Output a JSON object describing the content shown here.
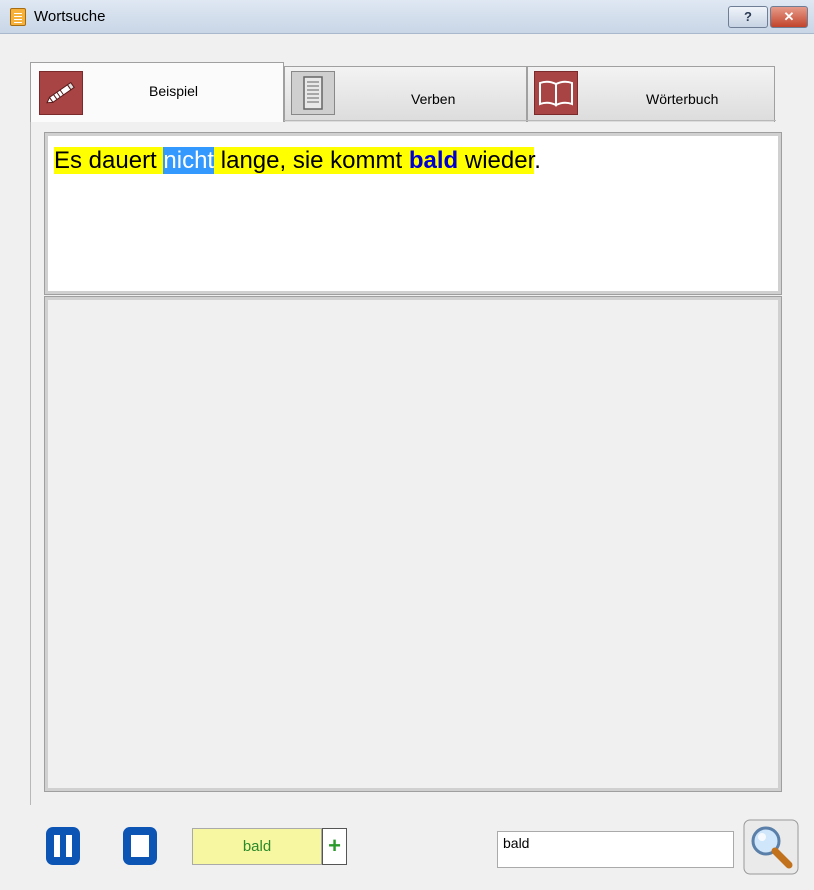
{
  "window": {
    "title": "Wortsuche",
    "help_label": "?",
    "close_label": "✕"
  },
  "tabs": [
    {
      "label": "Beispiel",
      "icon": "pen-icon",
      "active": true
    },
    {
      "label": "Verben",
      "icon": "document-list-icon",
      "active": false
    },
    {
      "label": "Wörterbuch",
      "icon": "open-book-icon",
      "active": false
    }
  ],
  "sentence": {
    "part1": "Es dauert ",
    "selected_word": "nicht",
    "part2": " lange, sie kommt ",
    "search_word": "bald",
    "part3": " wieder",
    "end": "."
  },
  "bottom": {
    "word_chip": "bald",
    "add_label": "+",
    "search_value": "bald"
  },
  "colors": {
    "highlight": "#ffff00",
    "selection": "#3399ff",
    "match_text": "#0000d0",
    "tab_icon_red": "#a84444",
    "media_blue": "#0c55b5"
  }
}
